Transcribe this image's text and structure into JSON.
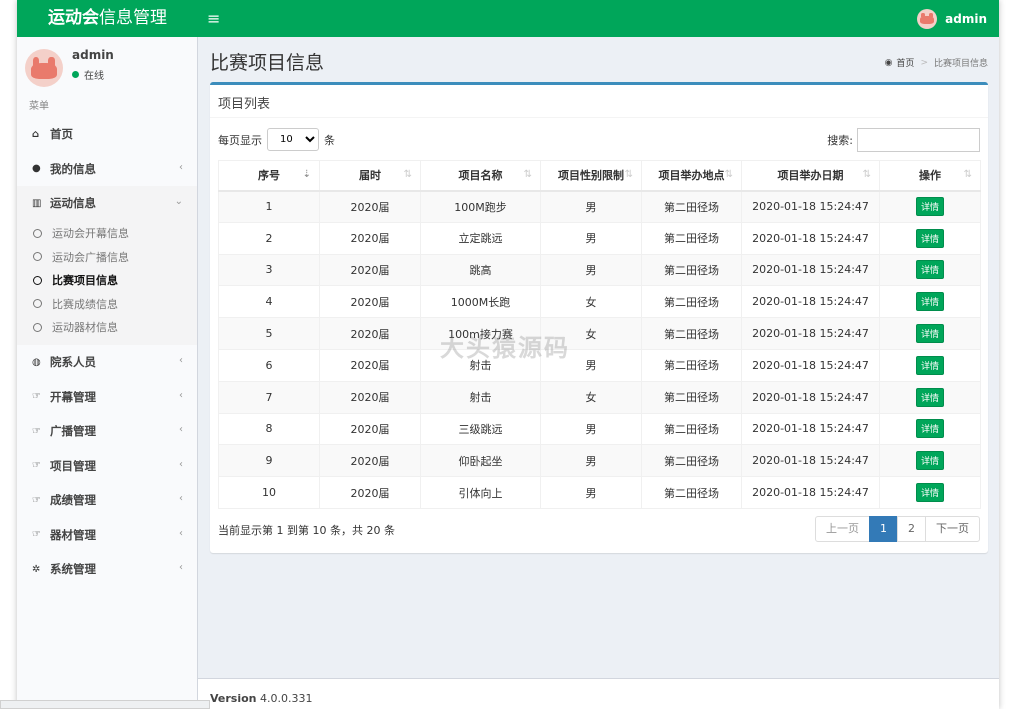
{
  "app": {
    "logo_bold": "运动会",
    "logo_rest": "信息管理"
  },
  "header": {
    "menu_icon": "bars-icon",
    "username": "admin"
  },
  "sidebar": {
    "username": "admin",
    "status": "在线",
    "menu_header": "菜单",
    "items": [
      {
        "label": "首页",
        "icon": "home-icon"
      },
      {
        "label": "我的信息",
        "icon": "user-icon"
      },
      {
        "label": "运动信息",
        "icon": "bar-chart-icon"
      },
      {
        "label": "院系人员",
        "icon": "users-icon"
      },
      {
        "label": "开幕管理",
        "icon": "thumbs-up-icon"
      },
      {
        "label": "广播管理",
        "icon": "thumbs-up-icon"
      },
      {
        "label": "项目管理",
        "icon": "thumbs-up-icon"
      },
      {
        "label": "成绩管理",
        "icon": "thumbs-up-icon"
      },
      {
        "label": "器材管理",
        "icon": "thumbs-up-icon"
      },
      {
        "label": "系统管理",
        "icon": "gear-icon"
      }
    ],
    "subitems": [
      "运动会开幕信息",
      "运动会广播信息",
      "比赛项目信息",
      "比赛成绩信息",
      "运动器材信息"
    ]
  },
  "page": {
    "title": "比赛项目信息",
    "breadcrumb_home": "首页",
    "breadcrumb_current": "比赛项目信息"
  },
  "box": {
    "title": "项目列表",
    "length_prefix": "每页显示",
    "length_value": "10",
    "length_suffix": "条",
    "search_label": "搜索:",
    "search_value": ""
  },
  "table": {
    "headers": [
      "序号",
      "届时",
      "项目名称",
      "项目性别限制",
      "项目举办地点",
      "项目举办日期",
      "操作"
    ],
    "detail_label": "详情",
    "rows": [
      [
        "1",
        "2020届",
        "100M跑步",
        "男",
        "第二田径场",
        "2020-01-18 15:24:47"
      ],
      [
        "2",
        "2020届",
        "立定跳远",
        "男",
        "第二田径场",
        "2020-01-18 15:24:47"
      ],
      [
        "3",
        "2020届",
        "跳高",
        "男",
        "第二田径场",
        "2020-01-18 15:24:47"
      ],
      [
        "4",
        "2020届",
        "1000M长跑",
        "女",
        "第二田径场",
        "2020-01-18 15:24:47"
      ],
      [
        "5",
        "2020届",
        "100m接力赛",
        "女",
        "第二田径场",
        "2020-01-18 15:24:47"
      ],
      [
        "6",
        "2020届",
        "射击",
        "男",
        "第二田径场",
        "2020-01-18 15:24:47"
      ],
      [
        "7",
        "2020届",
        "射击",
        "女",
        "第二田径场",
        "2020-01-18 15:24:47"
      ],
      [
        "8",
        "2020届",
        "三级跳远",
        "男",
        "第二田径场",
        "2020-01-18 15:24:47"
      ],
      [
        "9",
        "2020届",
        "仰卧起坐",
        "男",
        "第二田径场",
        "2020-01-18 15:24:47"
      ],
      [
        "10",
        "2020届",
        "引体向上",
        "男",
        "第二田径场",
        "2020-01-18 15:24:47"
      ]
    ]
  },
  "info": "当前显示第 1 到第 10 条，共 20 条",
  "pagination": {
    "prev": "上一页",
    "pages": [
      "1",
      "2"
    ],
    "next": "下一页"
  },
  "footer": {
    "version_label": "Version",
    "version_number": "4.0.0.331"
  },
  "watermark": "大头猿源码",
  "colors": {
    "header": "#00a65a",
    "accent": "#3c8dbc",
    "page_active": "#337ab7",
    "detail_button": "#00a65a"
  }
}
